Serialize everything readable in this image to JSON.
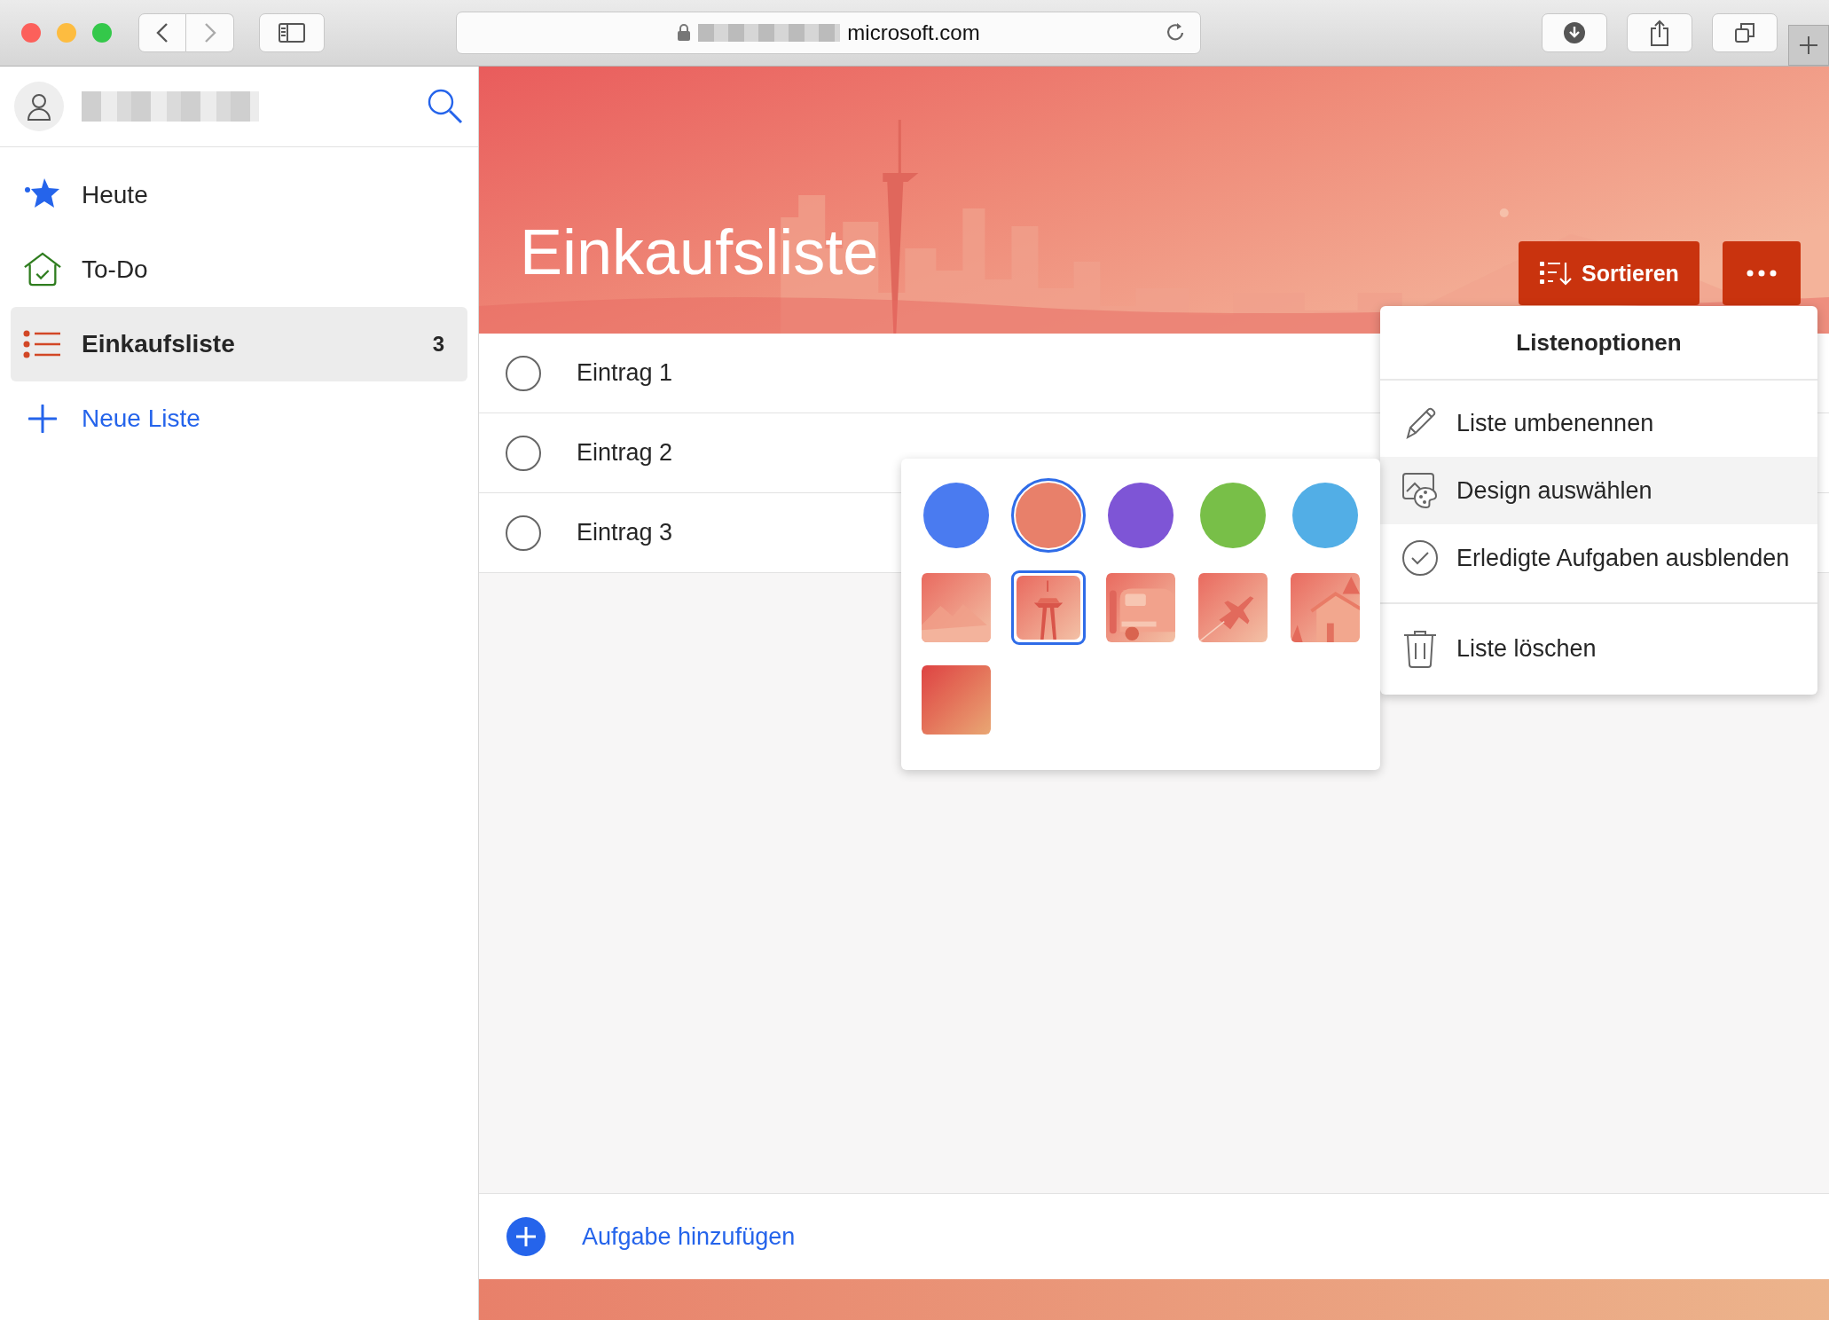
{
  "browser": {
    "address": "microsoft.com"
  },
  "sidebar": {
    "items": [
      {
        "label": "Heute",
        "kind": "today",
        "selected": false
      },
      {
        "label": "To-Do",
        "kind": "tasks",
        "selected": false
      },
      {
        "label": "Einkaufsliste",
        "kind": "list",
        "count": "3",
        "selected": true
      }
    ],
    "new_list": "Neue Liste"
  },
  "list": {
    "title": "Einkaufsliste",
    "sort_button": "Sortieren",
    "tasks": [
      {
        "title": "Eintrag 1",
        "completed": false
      },
      {
        "title": "Eintrag 2",
        "completed": false
      },
      {
        "title": "Eintrag 3",
        "completed": false
      }
    ],
    "add_task": "Aufgabe hinzufügen"
  },
  "menu": {
    "title": "Listenoptionen",
    "items": [
      {
        "label": "Liste umbenennen",
        "kind": "rename",
        "selected": false
      },
      {
        "label": "Design auswählen",
        "kind": "theme",
        "selected": true
      },
      {
        "label": "Erledigte Aufgaben ausblenden",
        "kind": "hide",
        "selected": false
      },
      {
        "label": "Liste löschen",
        "kind": "delete",
        "selected": false
      }
    ]
  },
  "theme_picker": {
    "colors": [
      {
        "color": "#4a7bf0",
        "selected": false
      },
      {
        "color": "#e8806a",
        "selected": true
      },
      {
        "color": "#7e55d6",
        "selected": false
      },
      {
        "color": "#78bf48",
        "selected": false
      },
      {
        "color": "#52aee6",
        "selected": false
      }
    ],
    "pictures": [
      {
        "kind": "mountains",
        "selected": false
      },
      {
        "kind": "tower",
        "selected": true
      },
      {
        "kind": "van",
        "selected": false
      },
      {
        "kind": "plane",
        "selected": false
      },
      {
        "kind": "cabin",
        "selected": false
      },
      {
        "kind": "gradient",
        "selected": false
      }
    ]
  }
}
